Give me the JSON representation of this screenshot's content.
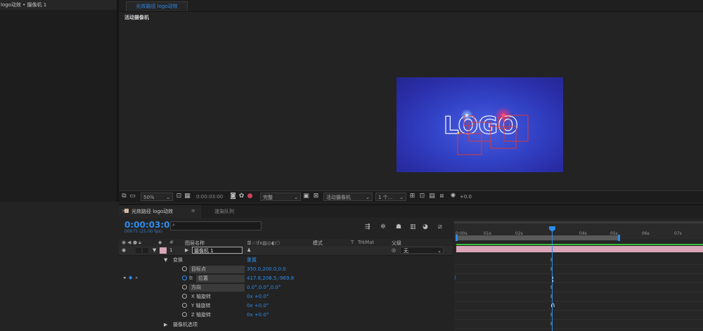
{
  "project_panel": {
    "title": "logo动效 • 摄像机 1"
  },
  "viewer": {
    "tab_label": "光效路径 logo动效",
    "camera_label": "活动摄像机",
    "canvas_logo": "LOGO"
  },
  "viewer_toolbar": {
    "zoom": "50%",
    "timecode": "0:00:03:00",
    "resolution": "完整",
    "camera": "活动摄像机",
    "views": "1 个...",
    "exposure": "+0.0"
  },
  "timeline": {
    "comp_tab": "光效路径 logo动效",
    "render_tab": "渲染队列",
    "timecode": "0:00:03:00",
    "frame_info": "00075 (25.00 fps)",
    "search_placeholder": "",
    "columns": {
      "num": "#",
      "layer_name": "图层名称",
      "switches": "单☆\\fx▨◎◐⬡",
      "mode": "模式",
      "t": "T",
      "trkmat": "TrkMat",
      "parent": "父级"
    },
    "layer": {
      "index": "1",
      "name": "摄像机 1",
      "parent_value": "无",
      "parent_mark": "◎"
    },
    "transform": {
      "label": "变换",
      "reset": "重置"
    },
    "properties": [
      {
        "name": "目标点",
        "value": "350.0,200.0,0.0"
      },
      {
        "name": "位置",
        "value": "417.8,208.5,-969.8"
      },
      {
        "name": "方向",
        "value": "0.0°,0.0°,0.0°"
      },
      {
        "name": "X 轴旋转",
        "value": "0x +0.0°"
      },
      {
        "name": "Y 轴旋转",
        "value": "0x +0.0°"
      },
      {
        "name": "Z 轴旋转",
        "value": "0x +0.0°"
      }
    ],
    "camera_options": "摄像机选项",
    "ruler_ticks": [
      "0:00s",
      "01s",
      "02s",
      "04s",
      "05s",
      "06s",
      "07s"
    ]
  },
  "colors": {
    "accent": "#2d8ceb",
    "layer_label": "#d9a6b8",
    "canvas": "#3344c8"
  }
}
